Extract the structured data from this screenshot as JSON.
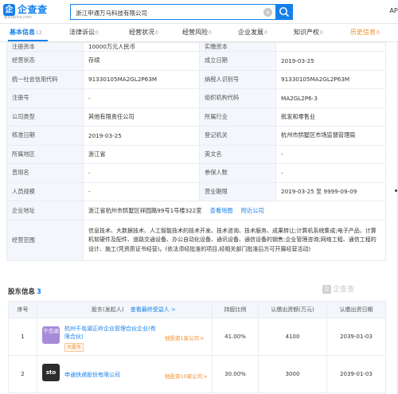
{
  "header": {
    "logo_char": "企",
    "logo_text": "企查查",
    "logo_sub": "qichacha.com",
    "search_value": "浙江申通万马科技有限公司",
    "search_clear": "×",
    "right_text": "API"
  },
  "tabs": [
    {
      "label": "基本信息",
      "count": "12"
    },
    {
      "label": "法律诉讼",
      "count": "0"
    },
    {
      "label": "经营状况",
      "count": "0"
    },
    {
      "label": "经营风险",
      "count": "0"
    },
    {
      "label": "企业发展",
      "count": "0"
    },
    {
      "label": "知识产权",
      "count": "0"
    },
    {
      "label": "历史信息",
      "count": "0"
    }
  ],
  "info": {
    "row0": {
      "l1": "注册资本",
      "v1": "10000万元人民币",
      "l2": "实缴资本",
      "v2": ""
    },
    "row1": {
      "l1": "经营状态",
      "v1": "存续",
      "l2": "成立日期",
      "v2": "2019-03-25"
    },
    "row2": {
      "l1": "统一社会信用代码",
      "v1": "91330105MA2GL2P63M",
      "l2": "纳税人识别号",
      "v2": "91330105MA2GL2P63M"
    },
    "row3": {
      "l1": "注册号",
      "v1": "-",
      "l2": "组织机构代码",
      "v2": "MA2GL2P6-3"
    },
    "row4": {
      "l1": "公司类型",
      "v1": "其他有限责任公司",
      "l2": "所属行业",
      "v2": "批发和零售业"
    },
    "row5": {
      "l1": "核准日期",
      "v1": "2019-03-25",
      "l2": "登记机关",
      "v2": "杭州市拱墅区市场监督管理局"
    },
    "row6": {
      "l1": "所属地区",
      "v1": "浙江省",
      "l2": "英文名",
      "v2": "-"
    },
    "row7": {
      "l1": "曾用名",
      "v1": "-",
      "l2": "参保人数",
      "v2": "-"
    },
    "row8": {
      "l1": "人员规模",
      "v1": "-",
      "l2": "营业期限",
      "v2": "2019-03-25 至 9999-09-09"
    },
    "address": {
      "label": "企业地址",
      "value": "浙江省杭州市拱墅区祥园路99号1号楼322室",
      "map_link": "查看地图",
      "nearby_link": "附近公司"
    },
    "scope": {
      "label": "经营范围",
      "value": "信息技术、大数据技术、人工智能技术的技术开发、技术咨询、技术服务、成果转让;计算机系统集成;电子产品、计算机软硬件及配件、道路交通设备、办公自动化设备、通讯设备、通信设备的销售;企业管理咨询;网络工程、通信工程的设计、施工(凭资质证书经营)。(依法须经批准的项目,经相关部门批准后方可开展经营活动)"
    }
  },
  "shareholders": {
    "title": "股东信息",
    "count": "3",
    "watermark": "企查查",
    "headers": {
      "index": "序号",
      "holder": "股东(发起人)",
      "holder_link": "查看最终受益人 >",
      "ratio": "持股比例",
      "amount": "认缴出资额(万元)",
      "date": "认缴出资日期"
    },
    "rows": [
      {
        "index": "1",
        "logo": "千岛湖",
        "name": "杭州千岛湖正岭企业管理合伙企业(有限合伙)",
        "tag": "大股东",
        "related": "他投资1家公司",
        "ratio": "41.00%",
        "amount": "4100",
        "date": "2039-01-03"
      },
      {
        "index": "2",
        "logo_a": "sto",
        "logo_b": "",
        "name": "申通快递股份有限公司",
        "tag": "",
        "related": "他投资10家公司",
        "ratio": "30.00%",
        "amount": "3000",
        "date": "2039-01-03"
      }
    ],
    "arrow": ">"
  },
  "colors": {
    "accent": "#1580ea",
    "history": "#f08a24",
    "label_bg": "#f3f6fb"
  }
}
